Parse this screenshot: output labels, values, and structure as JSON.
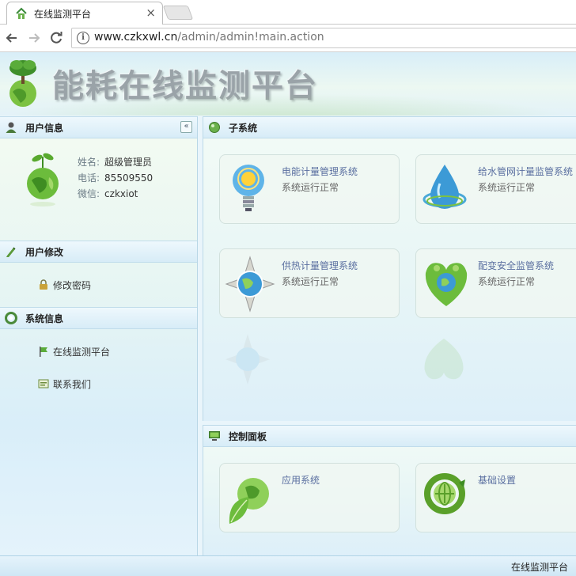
{
  "browser": {
    "tab_title": "在线监测平台",
    "close_glyph": "×",
    "url_host": "www.czkxwl.cn",
    "url_path": "/admin/admin!main.action"
  },
  "header": {
    "title": "能耗在线监测平台"
  },
  "sidebar": {
    "user_section": {
      "title": "用户信息",
      "collapse_glyph": "«",
      "name_label": "姓名:",
      "name_value": "超级管理员",
      "phone_label": "电话:",
      "phone_value": "85509550",
      "wechat_label": "微信:",
      "wechat_value": "czkxiot"
    },
    "edit_section": {
      "title": "用户修改",
      "change_password": "修改密码"
    },
    "system_section": {
      "title": "系统信息",
      "platform_link": "在线监测平台",
      "contact_link": "联系我们"
    }
  },
  "subsystems": {
    "title": "子系统",
    "cards": [
      {
        "name": "电能计量管理系统",
        "status": "系统运行正常",
        "icon": "lightbulb-icon"
      },
      {
        "name": "给水管网计量监管系统",
        "status": "系统运行正常",
        "icon": "water-drop-icon"
      },
      {
        "name": "供热计量管理系统",
        "status": "系统运行正常",
        "icon": "compass-globe-icon"
      },
      {
        "name": "配变安全监管系统",
        "status": "系统运行正常",
        "icon": "heart-globe-icon"
      }
    ]
  },
  "control_panel": {
    "title": "控制面板",
    "cards": [
      {
        "name": "应用系统",
        "icon": "leaf-globe-icon"
      },
      {
        "name": "基础设置",
        "icon": "recycle-globe-icon"
      }
    ]
  },
  "statusbar": {
    "text": "在线监测平台"
  },
  "colors": {
    "accent_blue": "#5a6fa0",
    "header_bg": "#d8eef8",
    "title_gray": "#9aa3a8"
  }
}
